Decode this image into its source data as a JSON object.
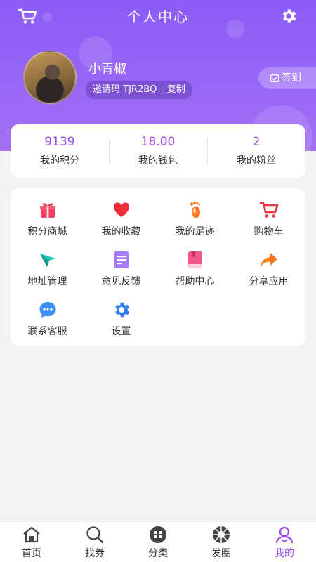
{
  "header": {
    "title": "个人中心",
    "user": {
      "name": "小青椒",
      "invite_label": "邀请码 TJR2BQ",
      "separator": "|",
      "copy_label": "复制"
    },
    "checkin_label": "签到"
  },
  "stats": [
    {
      "value": "9139",
      "label": "我的积分"
    },
    {
      "value": "18.00",
      "label": "我的钱包"
    },
    {
      "value": "2",
      "label": "我的粉丝"
    }
  ],
  "menu": [
    {
      "label": "积分商城",
      "icon": "gift-icon"
    },
    {
      "label": "我的收藏",
      "icon": "heart-icon"
    },
    {
      "label": "我的足迹",
      "icon": "footprint-icon"
    },
    {
      "label": "购物车",
      "icon": "cart-icon"
    },
    {
      "label": "地址管理",
      "icon": "location-icon"
    },
    {
      "label": "意见反馈",
      "icon": "feedback-icon"
    },
    {
      "label": "帮助中心",
      "icon": "book-icon"
    },
    {
      "label": "分享应用",
      "icon": "share-icon"
    },
    {
      "label": "联系客服",
      "icon": "chat-icon"
    },
    {
      "label": "设置",
      "icon": "gear-icon"
    }
  ],
  "tabs": [
    {
      "label": "首页",
      "icon": "home-icon"
    },
    {
      "label": "找券",
      "icon": "search-icon"
    },
    {
      "label": "分类",
      "icon": "category-icon"
    },
    {
      "label": "发圈",
      "icon": "aperture-icon"
    },
    {
      "label": "我的",
      "icon": "user-icon",
      "active": true
    }
  ],
  "colors": {
    "accent": "#9a4bf0",
    "header": "#8b5cf6"
  }
}
